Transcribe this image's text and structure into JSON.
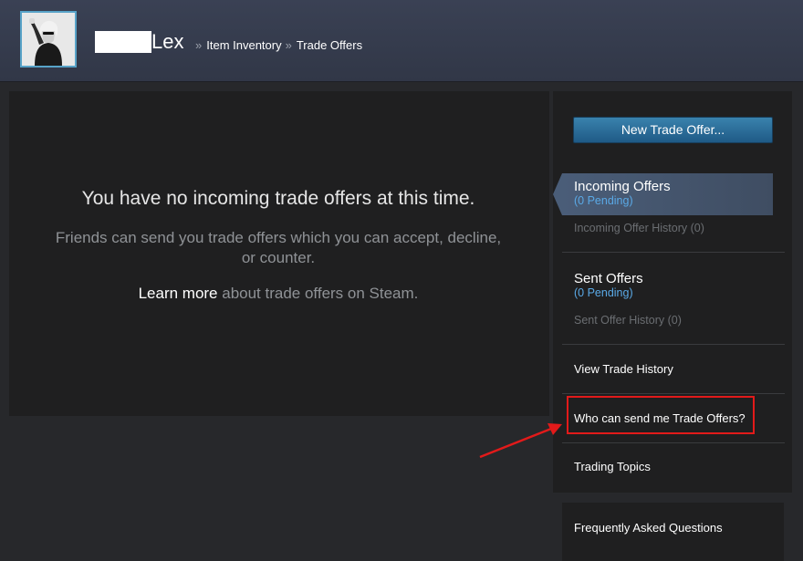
{
  "header": {
    "name_suffix": "Lex",
    "breadcrumb": [
      {
        "label": "Item Inventory"
      },
      {
        "label": "Trade Offers"
      }
    ],
    "separator": "»"
  },
  "main": {
    "empty_title": "You have no incoming trade offers at this time.",
    "empty_subtitle": "Friends can send you trade offers which you can accept, decline, or counter.",
    "learn_more_link": "Learn more",
    "learn_more_rest": " about trade offers on Steam."
  },
  "sidebar": {
    "new_offer_button": "New Trade Offer...",
    "incoming": {
      "title": "Incoming Offers",
      "pending": "(0 Pending)",
      "history": "Incoming Offer History (0)"
    },
    "sent": {
      "title": "Sent Offers",
      "pending": "(0 Pending)",
      "history": "Sent Offer History (0)"
    },
    "links": {
      "view_history": "View Trade History",
      "who_can_send": "Who can send me Trade Offers?",
      "trading_topics": "Trading Topics",
      "faq": "Frequently Asked Questions"
    }
  },
  "colors": {
    "accent_link": "#5aa9e6",
    "annotation_red": "#e21a1a",
    "header_bg": "#363c4e"
  }
}
